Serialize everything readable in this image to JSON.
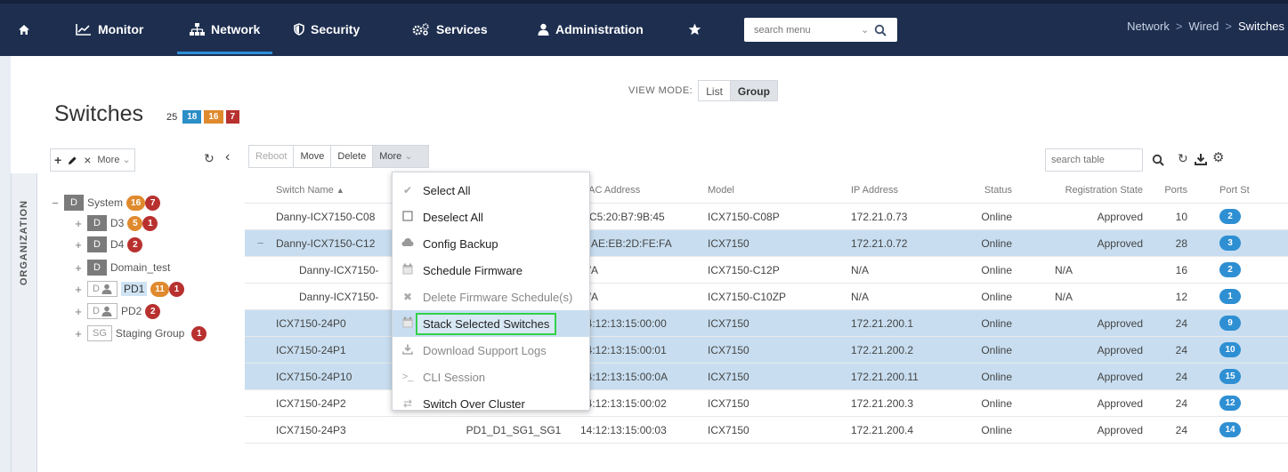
{
  "nav": {
    "items": [
      {
        "label": "Monitor",
        "icon": "line-chart-icon"
      },
      {
        "label": "Network",
        "icon": "network-icon",
        "active": true
      },
      {
        "label": "Security",
        "icon": "shield-icon"
      },
      {
        "label": "Services",
        "icon": "gears-icon"
      },
      {
        "label": "Administration",
        "icon": "user-icon"
      }
    ],
    "search_placeholder": "search menu",
    "breadcrumb": [
      "Network",
      "Wired",
      "Switches"
    ]
  },
  "page": {
    "title": "Switches",
    "counts": {
      "total": "25",
      "blue": "18",
      "orange": "16",
      "red": "7"
    },
    "view_mode_label": "VIEW MODE:",
    "view_modes": [
      "List",
      "Group"
    ],
    "org_label": "ORGANIZATION"
  },
  "tree_toolbar": {
    "more_label": "More"
  },
  "table_toolbar": {
    "reboot": "Reboot",
    "move": "Move",
    "delete": "Delete",
    "more": "More",
    "search_placeholder": "search table"
  },
  "tree": [
    {
      "label": "System",
      "box": "D",
      "badges": [
        "16",
        "7"
      ]
    },
    {
      "label": "D3",
      "box": "D",
      "badges": [
        "5",
        "1"
      ]
    },
    {
      "label": "D4",
      "box": "D",
      "badges": [
        "2"
      ]
    },
    {
      "label": "Domain_test",
      "box": "D",
      "badges": []
    },
    {
      "label": "PD1",
      "box": "D",
      "badges": [
        "11",
        "1"
      ]
    },
    {
      "label": "PD2",
      "box": "D",
      "badges": [
        "2"
      ]
    },
    {
      "label": "Staging Group",
      "box": "SG",
      "badges": [
        "1"
      ]
    }
  ],
  "table": {
    "headers": [
      "Switch Name",
      "",
      "MAC Address",
      "Model",
      "IP Address",
      "Status",
      "Registration State",
      "Ports",
      "Port St"
    ],
    "rows": [
      {
        "exp": "",
        "name": "Danny-ICX7150-C08",
        "group": "",
        "mac": "0:C5:20:B7:9B:45",
        "model": "ICX7150-C08P",
        "ip": "172.21.0.73",
        "status": "Online",
        "reg": "Approved",
        "ports": "10",
        "pst": "2",
        "sel": false
      },
      {
        "exp": "−",
        "name": "Danny-ICX7150-C12",
        "group": "",
        "mac": "C:AE:EB:2D:FE:FA",
        "model": "ICX7150",
        "ip": "172.21.0.72",
        "status": "Online",
        "reg": "Approved",
        "ports": "28",
        "pst": "3",
        "sel": true
      },
      {
        "exp": "",
        "name": "Danny-ICX7150-",
        "group": "",
        "mac": "N/A",
        "model": "ICX7150-C12P",
        "ip": "N/A",
        "status": "Online",
        "reg": "N/A",
        "ports": "16",
        "pst": "2",
        "sel": false,
        "sub": true
      },
      {
        "exp": "",
        "name": "Danny-ICX7150-",
        "group": "",
        "mac": "N/A",
        "model": "ICX7150-C10ZP",
        "ip": "N/A",
        "status": "Online",
        "reg": "N/A",
        "ports": "12",
        "pst": "1",
        "sel": false,
        "sub": true
      },
      {
        "exp": "",
        "name": "ICX7150-24P0",
        "group": "",
        "mac": "14:12:13:15:00:00",
        "model": "ICX7150",
        "ip": "172.21.200.1",
        "status": "Online",
        "reg": "Approved",
        "ports": "24",
        "pst": "9",
        "sel": true
      },
      {
        "exp": "",
        "name": "ICX7150-24P1",
        "group": "",
        "mac": "14:12:13:15:00:01",
        "model": "ICX7150",
        "ip": "172.21.200.2",
        "status": "Online",
        "reg": "Approved",
        "ports": "24",
        "pst": "10",
        "sel": true
      },
      {
        "exp": "",
        "name": "ICX7150-24P10",
        "group": "",
        "mac": "14:12:13:15:00:0A",
        "model": "ICX7150",
        "ip": "172.21.200.11",
        "status": "Online",
        "reg": "Approved",
        "ports": "24",
        "pst": "15",
        "sel": true
      },
      {
        "exp": "",
        "name": "ICX7150-24P2",
        "group": "PD1_D1_SG1_SG1",
        "mac": "14:12:13:15:00:02",
        "model": "ICX7150",
        "ip": "172.21.200.3",
        "status": "Online",
        "reg": "Approved",
        "ports": "24",
        "pst": "12",
        "sel": false
      },
      {
        "exp": "",
        "name": "ICX7150-24P3",
        "group": "PD1_D1_SG1_SG1",
        "mac": "14:12:13:15:00:03",
        "model": "ICX7150",
        "ip": "172.21.200.4",
        "status": "Online",
        "reg": "Approved",
        "ports": "24",
        "pst": "14",
        "sel": false
      }
    ]
  },
  "more_menu": [
    {
      "label": "Select All",
      "icon": "check-icon",
      "disabled": false
    },
    {
      "label": "Deselect All",
      "icon": "checkbox-icon",
      "disabled": false
    },
    {
      "label": "Config Backup",
      "icon": "cloud-icon",
      "disabled": false
    },
    {
      "label": "Schedule Firmware",
      "icon": "calendar-icon",
      "disabled": false
    },
    {
      "label": "Delete Firmware Schedule(s)",
      "icon": "delete-x-icon",
      "disabled": true
    },
    {
      "label": "Stack Selected Switches",
      "icon": "calendar-icon",
      "disabled": false,
      "highlighted": true
    },
    {
      "label": "Download Support Logs",
      "icon": "download-icon",
      "disabled": true
    },
    {
      "label": "CLI Session",
      "icon": "terminal-icon",
      "disabled": true
    },
    {
      "label": "Switch Over Cluster",
      "icon": "switch-arrows-icon",
      "disabled": false
    }
  ],
  "colors": {
    "nav_bg": "#1d2e4f",
    "accent": "#2c8fd6",
    "badge_orange": "#e08a2e",
    "badge_red": "#b8312f",
    "badge_blue": "#2b8ec6",
    "selected_row": "#c8def0",
    "highlight_border": "#32d14a"
  }
}
